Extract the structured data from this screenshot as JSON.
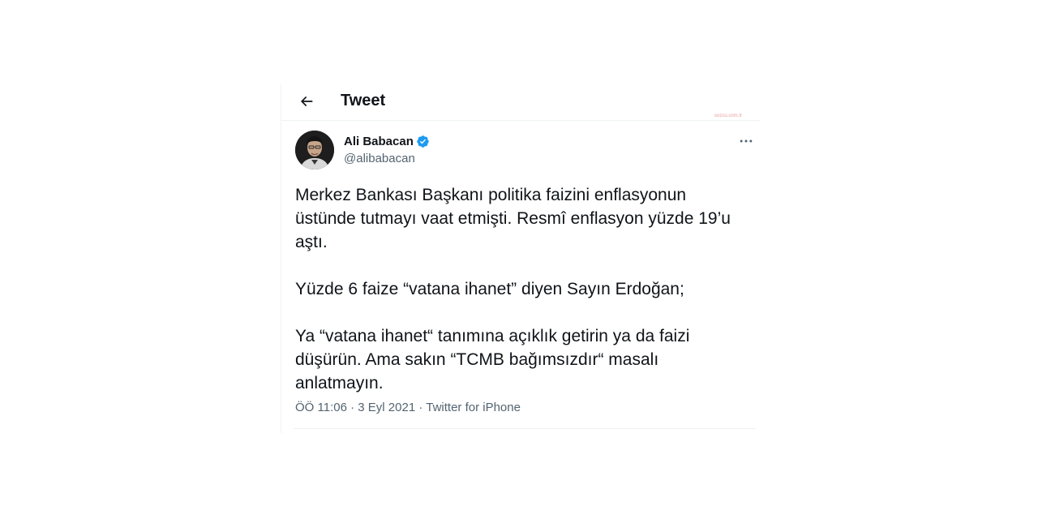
{
  "header": {
    "title": "Tweet",
    "watermark": "sozcu.com.tr"
  },
  "tweet": {
    "author": {
      "display_name": "Ali Babacan",
      "handle": "@alibabacan",
      "verified": true
    },
    "paragraphs": [
      "Merkez Bankası Başkanı politika faizini enflasyonun üstünde tutmayı vaat etmişti. Resmî enflasyon yüzde 19’u aştı.",
      "Yüzde 6 faize “vatana ihanet” diyen Sayın Erdoğan;",
      "Ya “vatana ihanet“ tanımına açıklık getirin ya da faizi düşürün. Ama sakın “TCMB bağımsızdır“ masalı anlatmayın."
    ],
    "meta": {
      "time": "ÖÖ 11:06",
      "separator": " · ",
      "date": "3 Eyl 2021",
      "source": "Twitter for iPhone"
    }
  },
  "icons": {
    "back": "arrow-left-icon",
    "more": "more-horizontal-icon",
    "verified": "verified-badge-icon"
  },
  "colors": {
    "text": "#0f1419",
    "secondary": "#536471",
    "verified": "#1d9bf0",
    "border": "#eff3f4"
  }
}
